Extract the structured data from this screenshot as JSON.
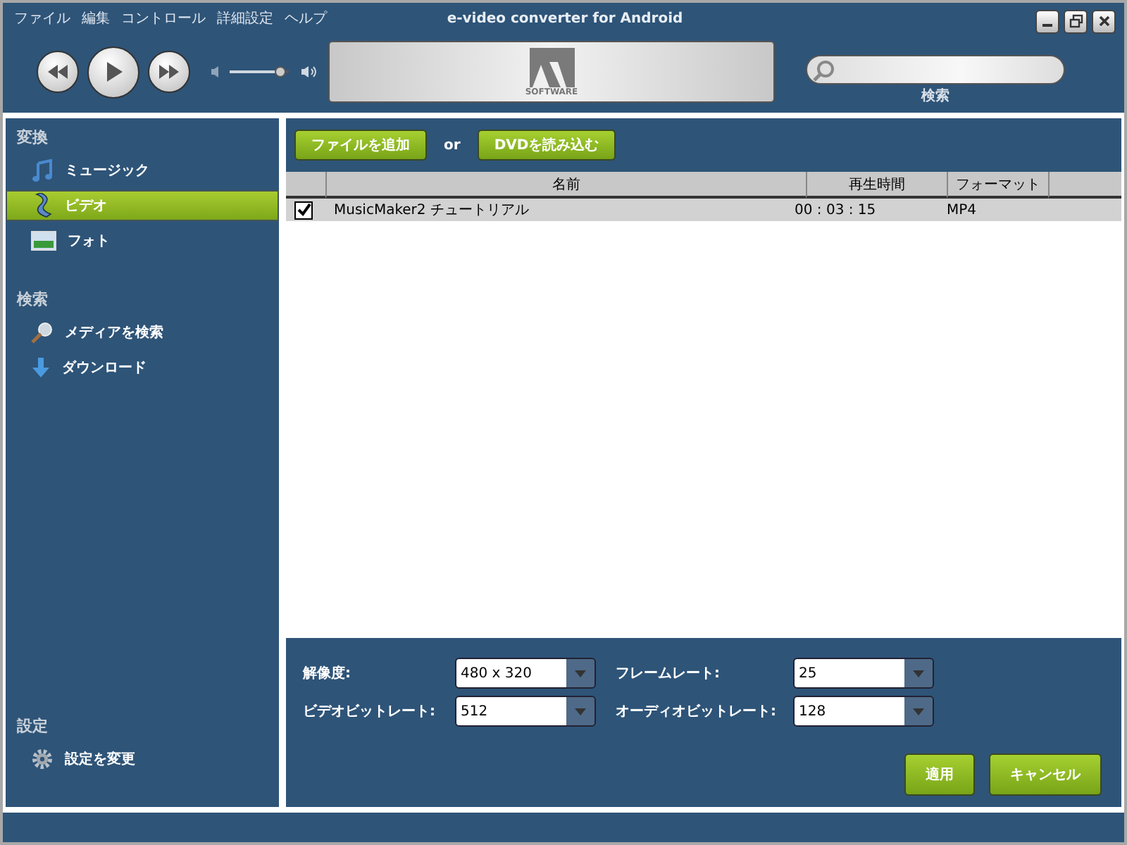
{
  "window": {
    "title": "e-video converter for Android"
  },
  "menu": [
    "ファイル",
    "編集",
    "コントロール",
    "詳細設定",
    "ヘルプ"
  ],
  "volume": {
    "level": 0.85
  },
  "logo": {
    "text": "SOFTWARE"
  },
  "search": {
    "label": "検索"
  },
  "sidebar": [
    {
      "title": "変換",
      "items": [
        {
          "label": "ミュージック",
          "kind": "music",
          "selected": false
        },
        {
          "label": "ビデオ",
          "kind": "video",
          "selected": true
        },
        {
          "label": "フォト",
          "kind": "photo",
          "selected": false
        }
      ]
    },
    {
      "title": "検索",
      "items": [
        {
          "label": "メディアを検索",
          "kind": "search",
          "selected": false
        },
        {
          "label": "ダウンロード",
          "kind": "download",
          "selected": false
        }
      ]
    },
    {
      "title": "設定",
      "items": [
        {
          "label": "設定を変更",
          "kind": "gear",
          "selected": false
        }
      ]
    }
  ],
  "toolbar": {
    "add_button": "ファイルを追加",
    "separator": "or",
    "dvd_button": "DVDを読み込む"
  },
  "table": {
    "columns": [
      "名前",
      "再生時間",
      "フォーマット"
    ],
    "rows": [
      {
        "checked": true,
        "name": "MusicMaker2 チュートリアル",
        "duration": "00 : 03 : 15",
        "format": "MP4"
      }
    ]
  },
  "settings": [
    {
      "label": "解像度:",
      "value": "480 x 320"
    },
    {
      "label": "フレームレート:",
      "value": "25"
    },
    {
      "label": "ビデオビットレート:",
      "value": "512"
    },
    {
      "label": "オーディオビットレート:",
      "value": "128"
    }
  ],
  "buttons": [
    "適用",
    "キャンセル"
  ]
}
